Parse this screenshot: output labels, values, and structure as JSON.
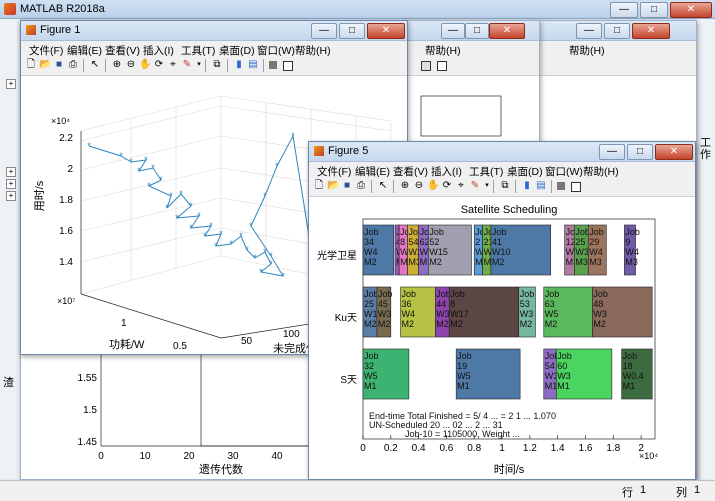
{
  "app": {
    "title": "MATLAB R2018a",
    "close": "✕",
    "min": "—",
    "max": "□"
  },
  "menu_items": [
    "文件(F)",
    "编辑(E)",
    "查看(V)",
    "插入(I)",
    "工具(T)",
    "桌面(D)",
    "窗口(W)",
    "帮助(H)"
  ],
  "fig1": {
    "title": "Figure 1",
    "zlabel": "用时/s",
    "ylabel": "功耗/W",
    "xlabel": "未完成任",
    "z_exp": "×10⁴",
    "y_exp": "×10⁷",
    "z_ticks": [
      "2.2",
      "2",
      "1.8",
      "1.6",
      "1.4"
    ],
    "y_ticks": [
      "1",
      "0.5"
    ],
    "x_ticks": [
      "50",
      "100"
    ]
  },
  "behind": {
    "xlabel": "遗传代数",
    "y_ticks": [
      "1.55",
      "1.5",
      "1.45"
    ],
    "x_ticks": [
      "0",
      "10",
      "20",
      "30",
      "40",
      "50",
      "60",
      "70"
    ],
    "side_labels": [
      "渣",
      "工作"
    ]
  },
  "fig5": {
    "title": "Figure 5",
    "chart_title": "Satellite Scheduling",
    "xlabel": "时间/s",
    "x_exp": "×10⁴",
    "x_ticks": [
      "0",
      "0.2",
      "0.4",
      "0.6",
      "0.8",
      "1",
      "1.2",
      "1.4",
      "1.6",
      "1.8",
      "2"
    ],
    "rows": [
      "光学卫星",
      "Ku天",
      "S天"
    ],
    "footer1": "End-time Total Finished = 5/ 4 ... = 2 1 ... 1.070",
    "footer2": "UN-Scheduled 20 ... 02 ... 2 ... 31",
    "footer3": "Job-10 = 1105000, Weight ... "
  },
  "chart_data": {
    "type": "table",
    "title": "Satellite Scheduling",
    "xlabel": "时间/s",
    "rows": [
      {
        "name": "光学卫星",
        "jobs": [
          {
            "label": [
              "Job",
              "34",
              "W4",
              "M2"
            ],
            "start": 0.0,
            "end": 0.22,
            "color": "#4e79a7"
          },
          {
            "label": [
              "Job",
              "4",
              "W4",
              "M3"
            ],
            "start": 0.23,
            "end": 0.26,
            "color": "#9b59b6"
          },
          {
            "label": [
              "Job",
              "8",
              "W3",
              "M3"
            ],
            "start": 0.26,
            "end": 0.32,
            "color": "#e377c2"
          },
          {
            "label": [
              "Job",
              "54",
              "W2",
              "M3"
            ],
            "start": 0.32,
            "end": 0.4,
            "color": "#c9b037"
          },
          {
            "label": [
              "Job",
              "62",
              "W4",
              "M3"
            ],
            "start": 0.4,
            "end": 0.47,
            "color": "#8e6cc2"
          },
          {
            "label": [
              "Job",
              "52",
              "W15",
              "M2"
            ],
            "start": 0.47,
            "end": 0.78,
            "color": "#a0a0b0"
          },
          {
            "label": [
              "Job",
              "2",
              "W3",
              "M3"
            ],
            "start": 0.8,
            "end": 0.86,
            "color": "#5b9bd5"
          },
          {
            "label": [
              "Job",
              "21",
              "W3",
              "M3"
            ],
            "start": 0.86,
            "end": 0.92,
            "color": "#70ad47"
          },
          {
            "label": [
              "Job",
              "41",
              "W10",
              "M2"
            ],
            "start": 0.92,
            "end": 1.35,
            "color": "#4e79a7"
          },
          {
            "label": [
              "Job",
              "12",
              "W3",
              "M3"
            ],
            "start": 1.45,
            "end": 1.52,
            "color": "#b07aa1"
          },
          {
            "label": [
              "Job",
              "25",
              "W3",
              "M3"
            ],
            "start": 1.52,
            "end": 1.62,
            "color": "#59a14f"
          },
          {
            "label": [
              "Job",
              "29",
              "W4",
              "M3"
            ],
            "start": 1.62,
            "end": 1.75,
            "color": "#9c755f"
          },
          {
            "label": [
              "Job",
              "9",
              "W4",
              "M3"
            ],
            "start": 1.88,
            "end": 1.96,
            "color": "#6f5ba7"
          }
        ]
      },
      {
        "name": "Ku天",
        "jobs": [
          {
            "label": [
              "Job",
              "25",
              "W1",
              "M2"
            ],
            "start": 0.0,
            "end": 0.1,
            "color": "#5a7fa7"
          },
          {
            "label": [
              "Job",
              "45",
              "W3",
              "M2"
            ],
            "start": 0.1,
            "end": 0.2,
            "color": "#7a6a4f"
          },
          {
            "label": [
              "Job",
              "36",
              "W4",
              "M2"
            ],
            "start": 0.27,
            "end": 0.52,
            "color": "#b5c244"
          },
          {
            "label": [
              "Job",
              "44",
              "W3",
              "M2"
            ],
            "start": 0.52,
            "end": 0.62,
            "color": "#8e44ad"
          },
          {
            "label": [
              "Job",
              "8",
              "W17",
              "M2"
            ],
            "start": 0.62,
            "end": 1.12,
            "color": "#5c4545"
          },
          {
            "label": [
              "Job",
              "53",
              "W3",
              "M2"
            ],
            "start": 1.12,
            "end": 1.24,
            "color": "#76b7a0"
          },
          {
            "label": [
              "Job",
              "63",
              "W5",
              "M2"
            ],
            "start": 1.3,
            "end": 1.65,
            "color": "#5cb85c"
          },
          {
            "label": [
              "Job",
              "48",
              "W3",
              "M2"
            ],
            "start": 1.65,
            "end": 2.08,
            "color": "#8a6a5a"
          }
        ]
      },
      {
        "name": "S天",
        "jobs": [
          {
            "label": [
              "Job",
              "32",
              "W5",
              "M1"
            ],
            "start": 0.0,
            "end": 0.33,
            "color": "#3cb371"
          },
          {
            "label": [
              "Job",
              "19",
              "W5",
              "M1"
            ],
            "start": 0.67,
            "end": 1.13,
            "color": "#4e79a7"
          },
          {
            "label": [
              "Job",
              "54",
              "W3",
              "M1"
            ],
            "start": 1.3,
            "end": 1.39,
            "color": "#8e6cc2"
          },
          {
            "label": [
              "Job",
              "60",
              "W3",
              "M1"
            ],
            "start": 1.39,
            "end": 1.79,
            "color": "#4cd460"
          },
          {
            "label": [
              "Job",
              "18",
              "W0.4",
              "M1"
            ],
            "start": 1.86,
            "end": 2.08,
            "color": "#3d6b40"
          }
        ]
      }
    ]
  },
  "status": {
    "row_label": "行",
    "row_value": "1",
    "col_label": "列",
    "col_value": "1"
  }
}
